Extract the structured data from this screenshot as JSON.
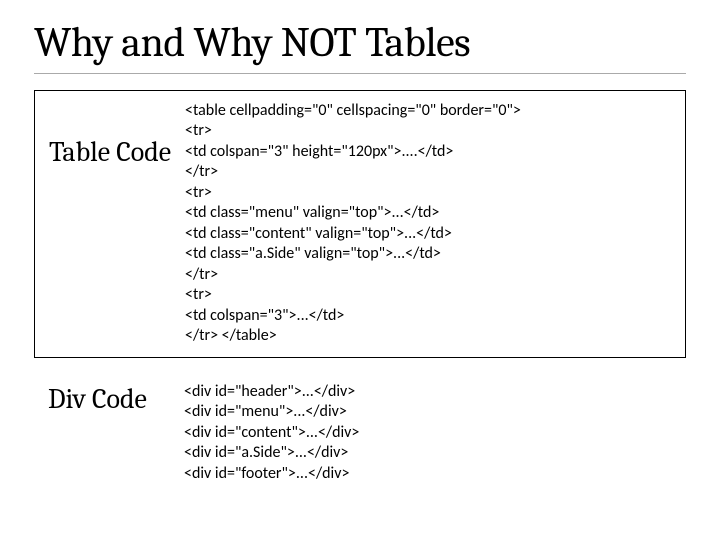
{
  "title": "Why and Why NOT Tables",
  "sections": [
    {
      "label": "Table\nCode",
      "code": "<table cellpadding=\"0\" cellspacing=\"0\" border=\"0\">\n<tr>\n<td colspan=\"3\" height=\"120px\">....</td>\n</tr>\n<tr>\n<td class=\"menu\" valign=\"top\">...</td>\n<td class=\"content\" valign=\"top\">...</td>\n<td class=\"a.Side\" valign=\"top\">...</td>\n</tr>\n<tr>\n<td colspan=\"3\">...</td>\n</tr> </table>"
    },
    {
      "label": "Div\nCode",
      "code": "<div id=\"header\">...</div>\n<div id=\"menu\">...</div>\n<div id=\"content\">...</div>\n<div id=\"a.Side\">...</div>\n<div id=\"footer\">...</div>"
    }
  ]
}
